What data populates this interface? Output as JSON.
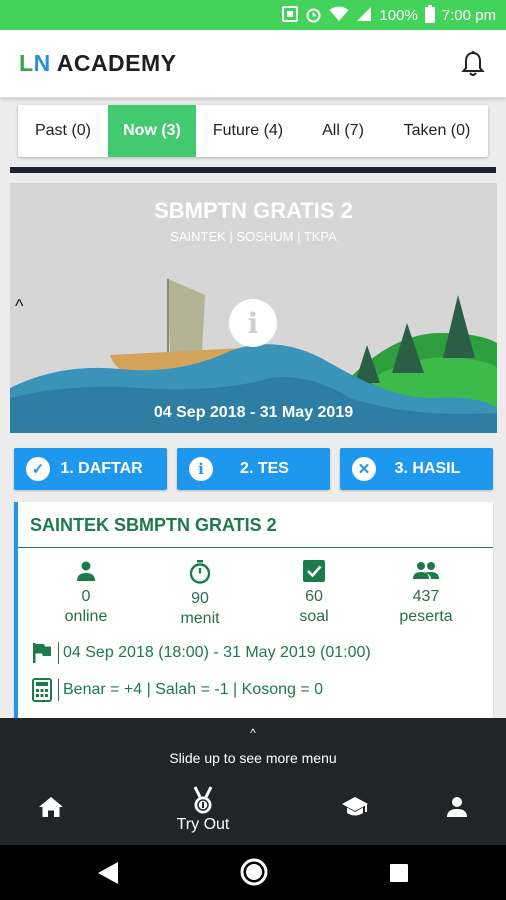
{
  "status_bar": {
    "battery": "100%",
    "time": "7:00 pm"
  },
  "app": {
    "logo_letter_l": "L",
    "logo_letter_n": "N",
    "logo_rest": " ACADEMY"
  },
  "tabs": [
    {
      "label": "Past (0)",
      "active": false
    },
    {
      "label": "Now (3)",
      "active": true
    },
    {
      "label": "Future (4)",
      "active": false
    },
    {
      "label": "All (7)",
      "active": false
    },
    {
      "label": "Taken (0)",
      "active": false
    }
  ],
  "event_card": {
    "title": "SBMPTN GRATIS 2",
    "subtitle": "SAINTEK | SOSHUM | TKPA",
    "date_range": "04 Sep 2018 - 31 May 2019",
    "collapse_glyph": "^",
    "info_glyph": "i"
  },
  "steps": [
    {
      "label": "1. DAFTAR",
      "icon": "check-icon",
      "glyph": "✓"
    },
    {
      "label": "2. TES",
      "icon": "info-icon",
      "glyph": "i"
    },
    {
      "label": "3. HASIL",
      "icon": "close-icon",
      "glyph": "✕"
    }
  ],
  "detail": {
    "title": "SAINTEK SBMPTN GRATIS 2",
    "stats": [
      {
        "value": "0",
        "label": "online",
        "icon": "person-icon"
      },
      {
        "value": "90",
        "label": "menit",
        "icon": "timer-icon"
      },
      {
        "value": "60",
        "label": "soal",
        "icon": "checkbox-icon"
      },
      {
        "value": "437",
        "label": "peserta",
        "icon": "people-icon"
      }
    ],
    "schedule": "04 Sep 2018 (18:00) - 31 May 2019 (01:00)",
    "scoring": "Benar = +4 | Salah = -1 | Kosong = 0"
  },
  "bottom_panel": {
    "handle": "^",
    "hint": "Slide up to see more menu",
    "nav": [
      "home-icon",
      "medal-icon",
      "graduation-cap-icon",
      "account-icon"
    ],
    "tryout_label": "Try Out"
  },
  "colors": {
    "status_green": "#43d35b",
    "tab_active": "#43c96f",
    "step_blue": "#1e97ee",
    "detail_green": "#1d7a4a",
    "bottom_dark": "#222527"
  }
}
